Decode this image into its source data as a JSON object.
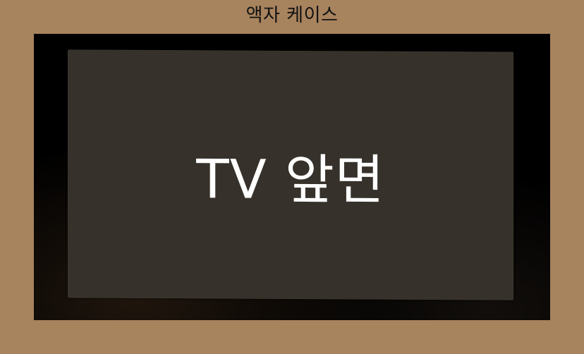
{
  "case": {
    "title": "액자 케이스"
  },
  "tv": {
    "screen_label": "TV 앞면"
  },
  "colors": {
    "background": "#a7835e",
    "frame": "#000000",
    "screen": "#36312a",
    "label": "#ffffff"
  }
}
